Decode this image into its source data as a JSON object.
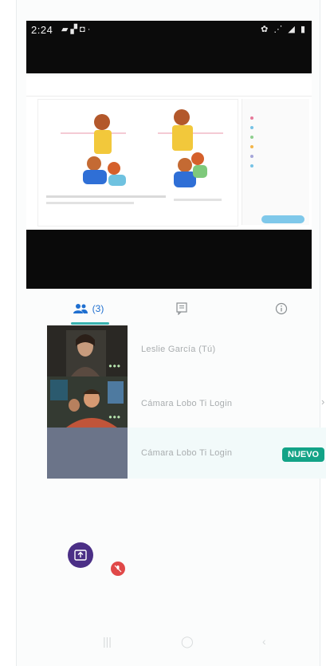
{
  "status_bar": {
    "time": "2:24",
    "left_icons": "▰ ▞ ◘ ·",
    "right_icons": "✿ ⋰ ◢ ▮"
  },
  "tabs": {
    "participants_count": "(3)",
    "chat_icon": "chat-icon",
    "info_icon": "info-icon"
  },
  "participants": [
    {
      "name": "Leslie García (Tú)",
      "dots": "•••"
    },
    {
      "name": "Cámara Lobo Ti Login",
      "dots": "•••"
    },
    {
      "name": "Cámara Lobo Ti Login",
      "badge": "NUEVO"
    }
  ],
  "colors": {
    "accent": "#38b3b0",
    "badge": "#13a387",
    "share": "#4b2f86",
    "mute": "#e04848"
  }
}
